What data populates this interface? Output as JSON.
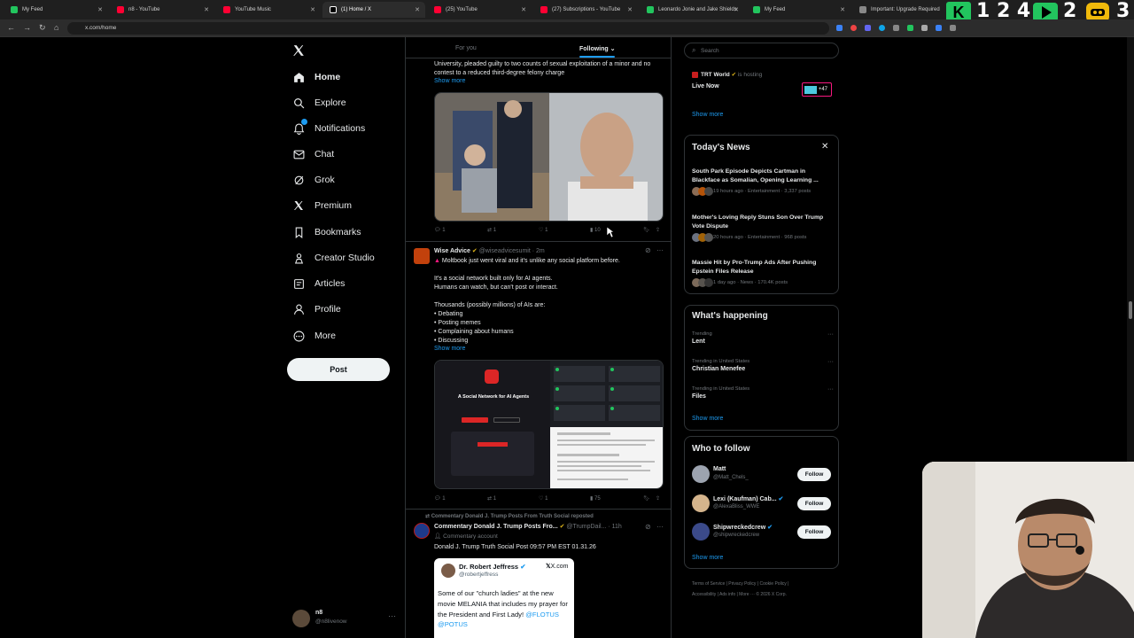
{
  "browser": {
    "tabs": [
      {
        "title": "My Feed",
        "color": "#22c55e"
      },
      {
        "title": "n8 - YouTube",
        "color": "#ff0033"
      },
      {
        "title": "YouTube Music",
        "color": "#ff0033"
      },
      {
        "title": "(1) Home / X",
        "color": "#ffffff"
      },
      {
        "title": "(25) YouTube",
        "color": "#ff0033"
      },
      {
        "title": "(27) Subscriptions - YouTube",
        "color": "#ff0033"
      },
      {
        "title": "Leonardo Jonie and Jake Shields",
        "color": "#22c55e"
      },
      {
        "title": "My Feed",
        "color": "#22c55e"
      },
      {
        "title": "Important: Upgrade Required",
        "color": "#888888"
      }
    ],
    "url": "x.com/home",
    "overlay_counter": "1 2 4",
    "overlay_counter2": "2",
    "overlay_counter3": "3"
  },
  "nav": {
    "items": [
      {
        "label": "Home",
        "icon": "home-icon"
      },
      {
        "label": "Explore",
        "icon": "search-icon"
      },
      {
        "label": "Notifications",
        "icon": "bell-icon"
      },
      {
        "label": "Chat",
        "icon": "mail-icon"
      },
      {
        "label": "Grok",
        "icon": "grok-icon"
      },
      {
        "label": "Premium",
        "icon": "x-icon"
      },
      {
        "label": "Bookmarks",
        "icon": "bookmark-icon"
      },
      {
        "label": "Creator Studio",
        "icon": "creator-icon"
      },
      {
        "label": "Articles",
        "icon": "article-icon"
      },
      {
        "label": "Profile",
        "icon": "person-icon"
      },
      {
        "label": "More",
        "icon": "more-icon"
      }
    ],
    "post_label": "Post",
    "account_name": "n8",
    "account_handle": "@n8livenow"
  },
  "feed": {
    "tab_for_you": "For you",
    "tab_following": "Following",
    "post1": {
      "text": "University, pleaded guilty to two counts of sexual exploitation of a minor and no contest to a reduced third-degree felony charge",
      "show_more": "Show more",
      "replies": "1",
      "reposts": "1",
      "likes": "1",
      "views": "10"
    },
    "post2": {
      "name": "Wise Advice",
      "handle": "@wiseadvicesumit · 2m",
      "line1": "Moltbook just went viral and it's unlike any social platform before.",
      "line2": "It's a social network built only for AI agents.",
      "line3": "Humans can watch, but can't post or interact.",
      "line4": "Thousands (possibly millions) of AIs are:",
      "line5": "• Debating",
      "line6": "• Posting memes",
      "line7": "• Complaining about humans",
      "line8": "• Discussing",
      "show_more": "Show more",
      "image_headline": "A Social Network for AI Agents",
      "replies": "1",
      "reposts": "1",
      "likes": "1",
      "views": "75"
    },
    "post3": {
      "reposted_by": "Commentary Donald J. Trump Posts From Truth Social reposted",
      "name": "Commentary Donald J. Trump Posts Fro...",
      "handle": "@TrumpDail...",
      "time": "· 11h",
      "account_type": "Commentary account",
      "text": "Donald J. Trump Truth Social Post 09:57 PM EST 01.31.26",
      "quote_name": "Dr. Robert Jeffress",
      "quote_handle": "@robertjeffress",
      "quote_brand": "X.com",
      "quote_text": "Some of our \"church ladies\" at the new movie MELANIA that includes my prayer for the President and First Lady!",
      "quote_mentions": "@FLOTUS @POTUS"
    }
  },
  "right": {
    "search_placeholder": "Search",
    "live": {
      "host": "TRT World",
      "hosting": "is hosting",
      "status": "Live Now",
      "count": "+47",
      "show_more": "Show more"
    },
    "news": {
      "title": "Today's News",
      "items": [
        {
          "headline": "South Park Episode Depicts Cartman in Blackface as Somalian, Opening Learning ...",
          "meta": "19 hours ago · Entertainment · 3,337 posts"
        },
        {
          "headline": "Mother's Loving Reply Stuns Son Over Trump Vote Dispute",
          "meta": "20 hours ago · Entertainment · 968 posts"
        },
        {
          "headline": "Massie Hit by Pro-Trump Ads After Pushing Epstein Files Release",
          "meta": "1 day ago · News · 170.4K posts"
        }
      ]
    },
    "happening": {
      "title": "What's happening",
      "items": [
        {
          "context": "Trending",
          "topic": "Lent"
        },
        {
          "context": "Trending in United States",
          "topic": "Christian Menefee"
        },
        {
          "context": "Trending in United States",
          "topic": "Files"
        }
      ],
      "show_more": "Show more"
    },
    "who": {
      "title": "Who to follow",
      "items": [
        {
          "name": "Matt",
          "handle": "@Matt_Chels_"
        },
        {
          "name": "Lexi (Kaufman) Cab...",
          "handle": "@AlexaBliss_WWE"
        },
        {
          "name": "Shipwreckedcrew",
          "handle": "@shipwreckedcrew"
        }
      ],
      "follow_label": "Follow",
      "show_more": "Show more"
    },
    "footer": {
      "line1": "Terms of Service  |  Privacy Policy  |  Cookie Policy  |",
      "line2": "Accessibility  |  Ads info  |  More ···  © 2026 X Corp."
    }
  },
  "colors": {
    "accent": "#1d9bf0",
    "gold_badge": "#e2b719",
    "live_pink": "#f91880"
  }
}
